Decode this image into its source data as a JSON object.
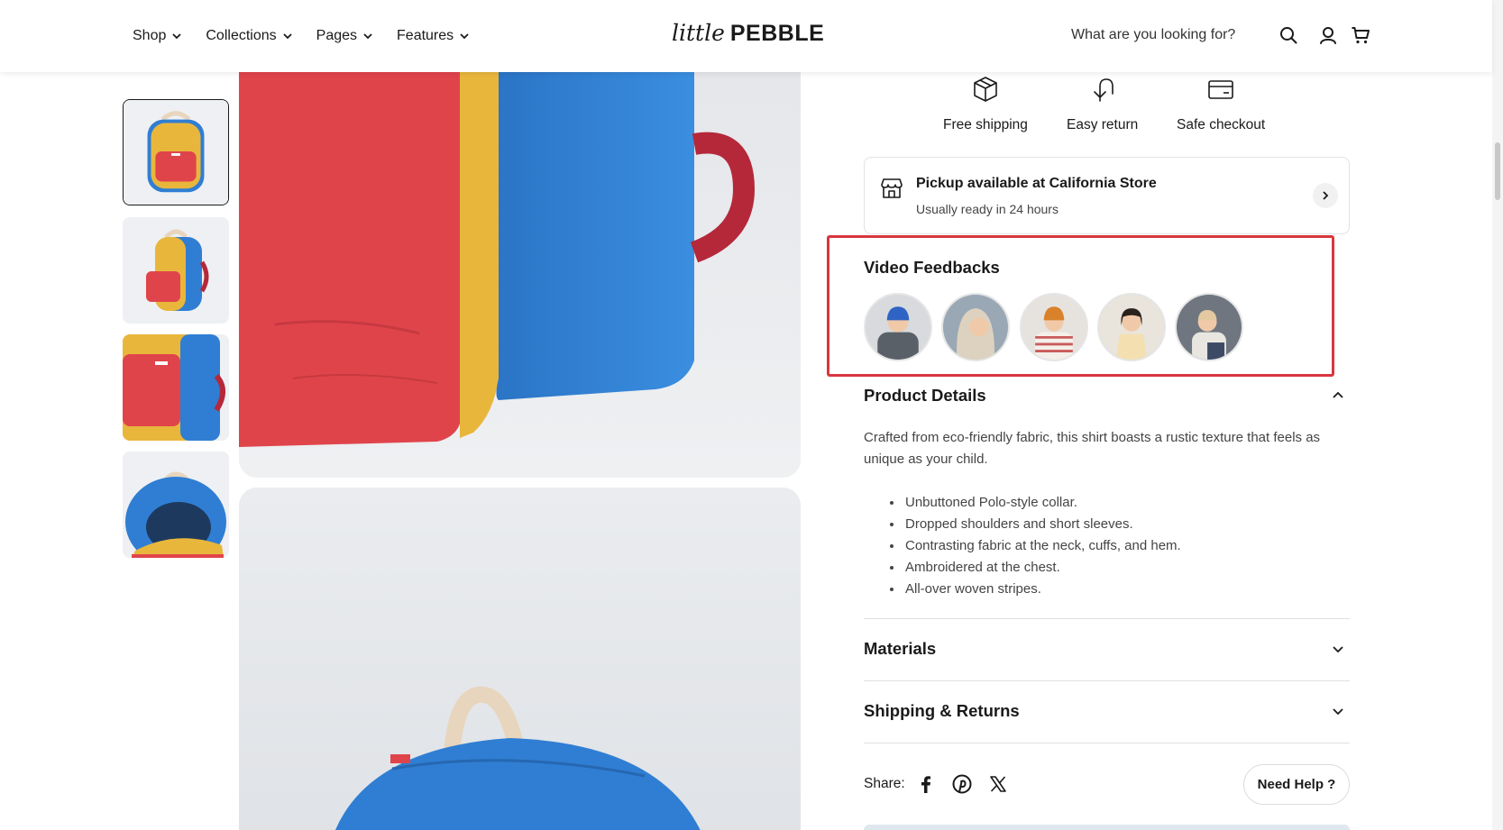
{
  "header": {
    "nav": [
      {
        "label": "Shop",
        "icon": "chevron-down-icon"
      },
      {
        "label": "Collections",
        "icon": "chevron-down-icon"
      },
      {
        "label": "Pages",
        "icon": "chevron-down-icon"
      },
      {
        "label": "Features",
        "icon": "chevron-down-icon"
      }
    ],
    "logo": {
      "script": "little",
      "main": "PEBBLE"
    },
    "search_placeholder": "What are you looking for?",
    "icons": [
      "search-icon",
      "account-icon",
      "cart-icon"
    ]
  },
  "gallery": {
    "thumbnails": [
      "backpack-front",
      "backpack-side",
      "backpack-detail",
      "backpack-open"
    ],
    "active_thumbnail": 0,
    "colors": {
      "red": "#e0444b",
      "yellow": "#e9b63c",
      "blue": "#2f7ed3",
      "maroon": "#b5283a",
      "beige": "#e8d5bd"
    }
  },
  "features": [
    {
      "label": "Free shipping",
      "icon": "box-icon"
    },
    {
      "label": "Easy return",
      "icon": "return-arrow-icon"
    },
    {
      "label": "Safe checkout",
      "icon": "credit-card-icon"
    }
  ],
  "pickup": {
    "title": "Pickup available at California Store",
    "subtitle": "Usually ready in 24 hours",
    "icon": "store-icon"
  },
  "video_feedbacks": {
    "title": "Video Feedbacks",
    "highlight_color": "#d9363e",
    "avatars": 5
  },
  "product_details": {
    "title": "Product Details",
    "expanded": true,
    "description": "Crafted from eco-friendly fabric, this shirt boasts a rustic texture that feels as unique as your child.",
    "bullets": [
      "Unbuttoned Polo-style collar.",
      "Dropped shoulders and short sleeves.",
      "Contrasting fabric at the neck, cuffs, and hem.",
      "Ambroidered at the chest.",
      "All-over woven stripes."
    ]
  },
  "accordions": [
    {
      "title": "Materials",
      "expanded": false
    },
    {
      "title": "Shipping & Returns",
      "expanded": false
    }
  ],
  "share": {
    "label": "Share:",
    "icons": [
      "facebook-icon",
      "pinterest-icon",
      "x-icon"
    ]
  },
  "help_button": "Need Help ?"
}
